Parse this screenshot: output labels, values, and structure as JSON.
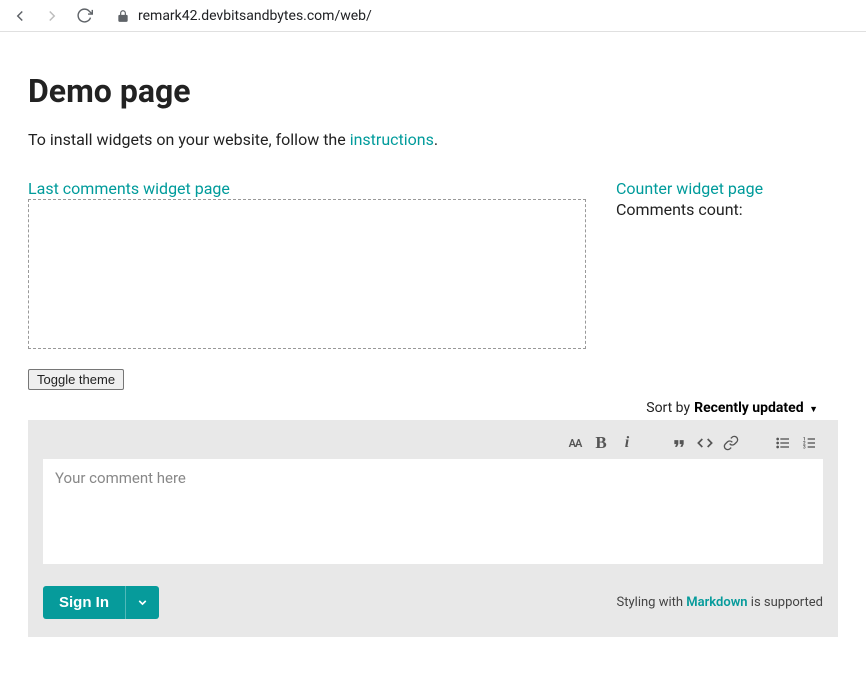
{
  "browser": {
    "url": "remark42.devbitsandbytes.com/web/"
  },
  "page": {
    "title": "Demo page",
    "install_prefix": "To install widgets on your website, follow the ",
    "install_link": "instructions",
    "install_suffix": "."
  },
  "widgets": {
    "last_comments_link": "Last comments widget page",
    "counter_link": "Counter widget page",
    "comments_count_label": "Comments count:"
  },
  "toggle_label": "Toggle theme",
  "sort": {
    "prefix": "Sort by",
    "value": "Recently updated"
  },
  "comment": {
    "placeholder": "Your comment here",
    "signin": "Sign In",
    "md_prefix": "Styling with ",
    "md_link": "Markdown",
    "md_suffix": " is supported"
  }
}
